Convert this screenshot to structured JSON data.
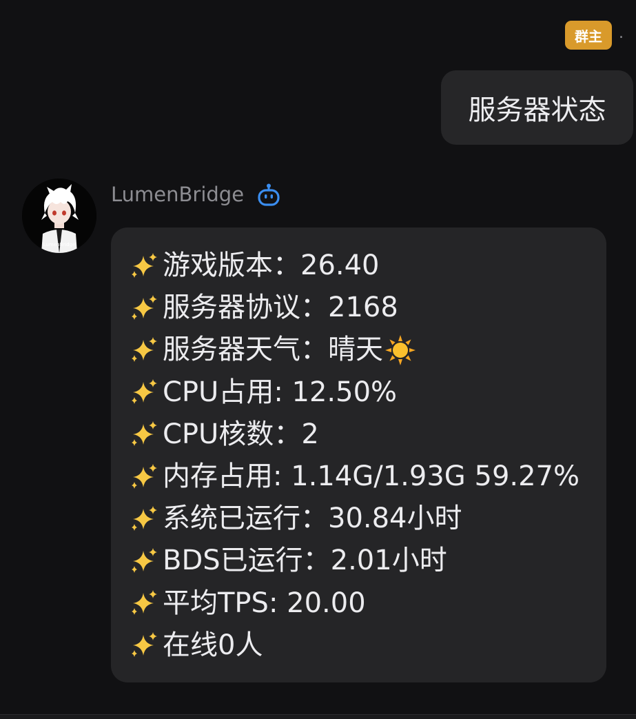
{
  "outgoing": {
    "role_badge": "群主",
    "sender_name": ".",
    "text": "服务器状态"
  },
  "bot": {
    "name": "LumenBridge",
    "avatar_caption": "LumenBridge",
    "badge_icon": "robot-icon",
    "bubble_color": "#252527",
    "lines": [
      "游戏版本：26.40",
      "服务器协议：2168",
      "服务器天气：晴天",
      "CPU占用: 12.50%",
      "CPU核数：2",
      "内存占用: 1.14G/1.93G 59.27%",
      "系统已运行：30.84小时",
      "BDS已运行：2.01小时",
      "平均TPS: 20.00",
      "在线0人"
    ],
    "line_icon": "sparkles-icon",
    "weather_icon": "sun-icon"
  },
  "colors": {
    "background": "#111113",
    "role_badge": "#d99a2b",
    "bot_badge": "#3b8ef0"
  }
}
